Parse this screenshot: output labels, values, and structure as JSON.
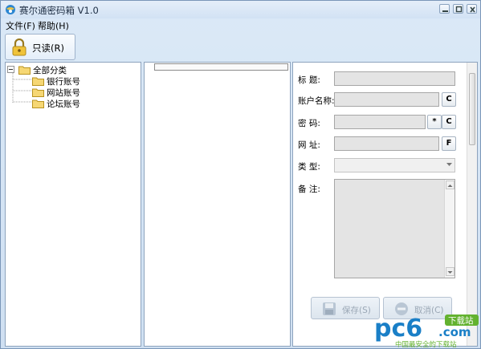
{
  "window": {
    "title": "赛尔通密码箱 V1.0"
  },
  "menu": {
    "file": "文件(F)",
    "help": "帮助(H)"
  },
  "toolbar": {
    "readonly_label": "只读(R)"
  },
  "tree": {
    "root": "全部分类",
    "children": [
      "银行账号",
      "网站账号",
      "论坛账号"
    ]
  },
  "form": {
    "title_label": "标    题:",
    "account_label": "账户名称:",
    "password_label": "密    码:",
    "url_label": "网    址:",
    "type_label": "类    型:",
    "notes_label": "备    注:",
    "copy_btn": "C",
    "mask_btn": "*",
    "open_btn": "F",
    "title_value": "",
    "account_value": "",
    "password_value": "",
    "url_value": "",
    "type_value": "",
    "notes_value": ""
  },
  "actions": {
    "save": "保存(S)",
    "cancel": "取消(C)"
  },
  "watermark": {
    "brand": "pc6",
    "domain": ".com",
    "tag": "下载站",
    "slogan": "中国最安全的下载站"
  },
  "colors": {
    "accent": "#1a7fc7",
    "watermark_green": "#63b22f"
  }
}
